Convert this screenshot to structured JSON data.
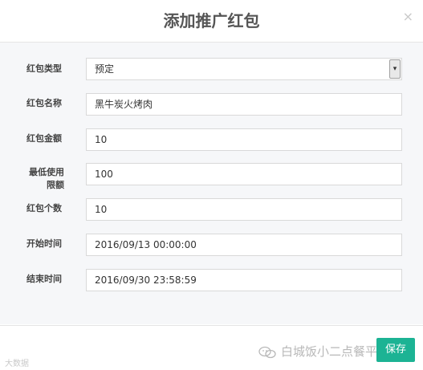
{
  "modal": {
    "title": "添加推广红包",
    "close_glyph": "×"
  },
  "form": {
    "type": {
      "label": "红包类型",
      "value": "预定",
      "arrow": "▾"
    },
    "name": {
      "label": "红包名称",
      "value": "黑牛炭火烤肉"
    },
    "amount": {
      "label": "红包金额",
      "value": "10"
    },
    "min_limit": {
      "label_line1": "最低使用",
      "label_line2": "限额",
      "value": "100"
    },
    "count": {
      "label": "红包个数",
      "value": "10"
    },
    "start_time": {
      "label": "开始时间",
      "value": "2016/09/13 00:00:00"
    },
    "end_time": {
      "label": "结束时间",
      "value": "2016/09/30 23:58:59"
    }
  },
  "footer": {
    "save_label": "保存",
    "watermark_text": "白城饭小二点餐平台",
    "watermark_left": "大数据"
  },
  "colors": {
    "accent": "#1cb394",
    "body_bg": "#f6f7f9"
  },
  "icons": {
    "close": "close-icon",
    "dropdown": "chevron-down-icon",
    "watermark": "wechat-logo-icon"
  }
}
